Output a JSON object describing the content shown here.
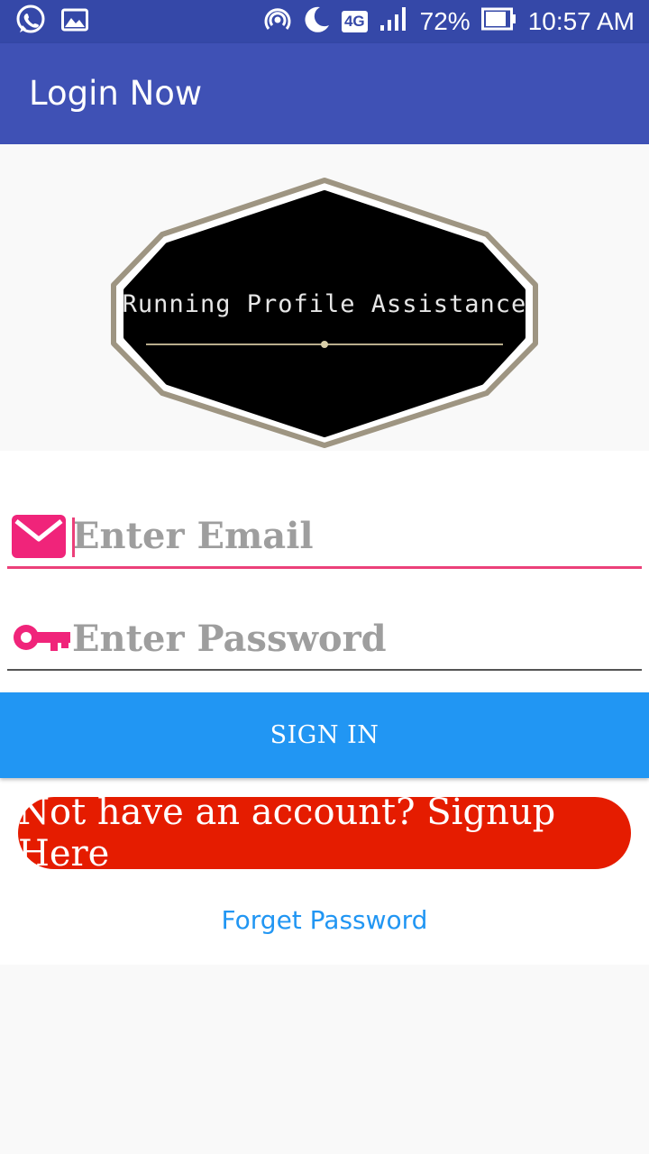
{
  "status_bar": {
    "battery_percent": "72%",
    "time": "10:57 AM",
    "network": "4G",
    "icons": [
      "whatsapp-icon",
      "gallery-icon",
      "hotspot-icon",
      "do-not-disturb-moon-icon",
      "signal-icon",
      "battery-icon"
    ]
  },
  "appbar": {
    "title": "Login Now"
  },
  "logo": {
    "text": "Running Profile Assistance"
  },
  "form": {
    "email": {
      "placeholder": "Enter Email",
      "value": "",
      "icon": "mail-icon"
    },
    "password": {
      "placeholder": "Enter Password",
      "value": "",
      "icon": "key-icon"
    },
    "signin_label": "SIGN IN",
    "signup_label": "Not have an account? Signup Here",
    "forget_label": "Forget Password"
  },
  "colors": {
    "status_bar": "#3548a8",
    "appbar": "#3f51b5",
    "accent_pink": "#ec407a",
    "signin_blue": "#2196f3",
    "signup_red": "#e51c00"
  }
}
